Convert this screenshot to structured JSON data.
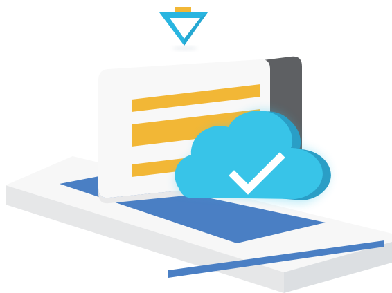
{
  "illustration": {
    "subject": "cloud-sync-card",
    "colors": {
      "background": "#ffffff",
      "platform_top": "#f7f7f7",
      "platform_side": "#e6e7e8",
      "platform_stripe": "#4a7fc4",
      "blue_mat": "#4a7fc4",
      "card_face": "#f8f8f8",
      "card_side": "#5e6063",
      "card_bars": "#f2b736",
      "cloud_front": "#38c4e8",
      "cloud_back": "#2a9ec6",
      "check_mark": "#ffffff",
      "marker_outer": "#29b5e0",
      "marker_inner": "#ffffff",
      "marker_tab": "#f2b736"
    },
    "icons": [
      "triangle-marker-icon",
      "cloud-icon",
      "checkmark-icon"
    ]
  }
}
